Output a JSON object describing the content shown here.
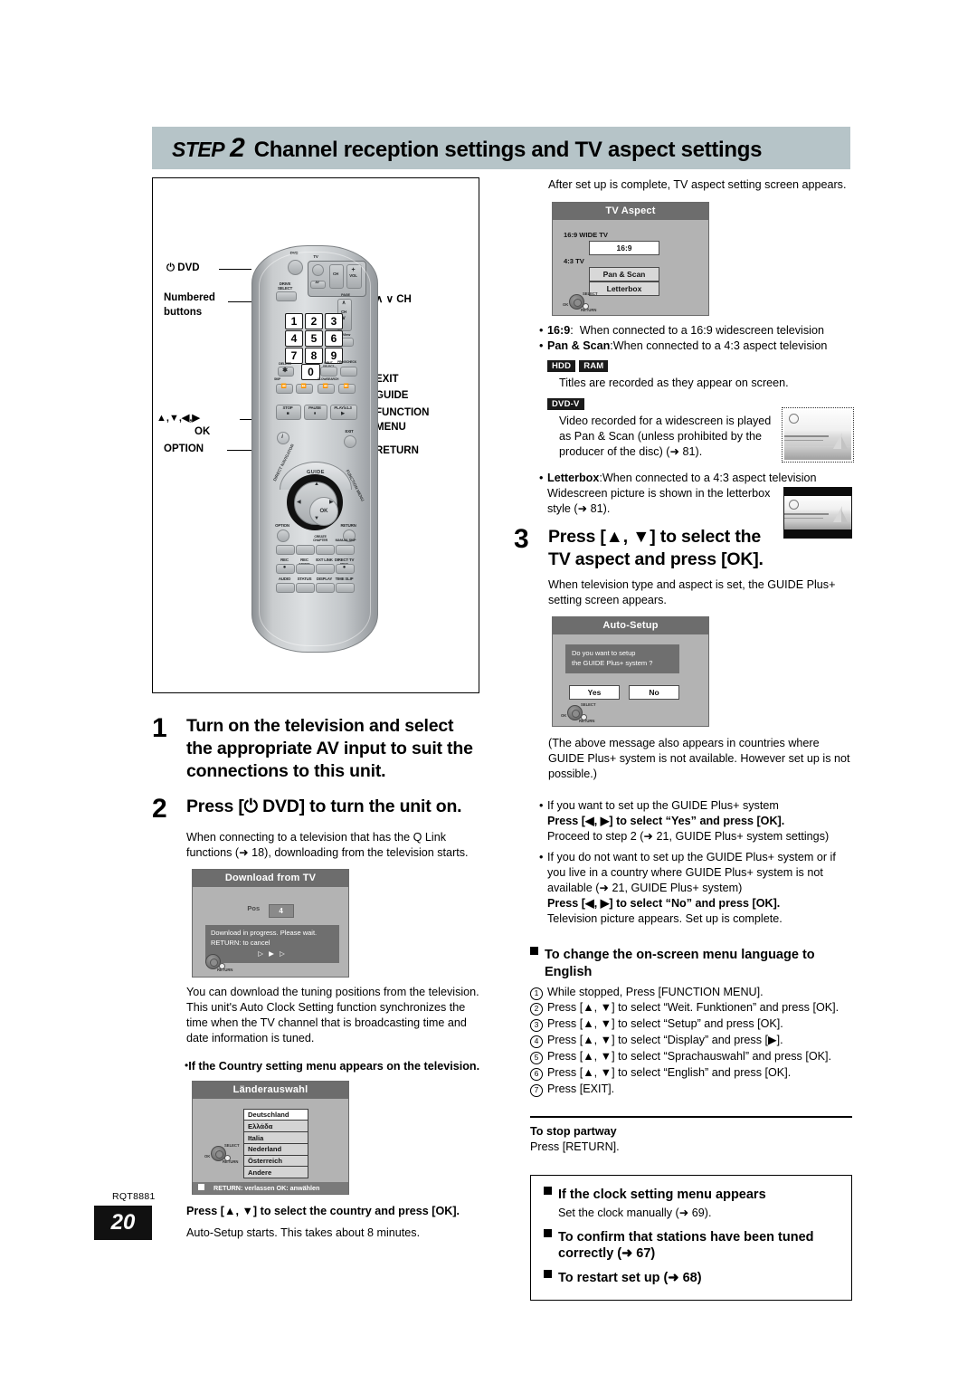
{
  "header": {
    "step_word": "STEP",
    "step_number": "2",
    "title": "Channel reception settings and TV aspect settings"
  },
  "remote_callouts": {
    "power_dvd": "⏻ DVD",
    "numbered_buttons": "Numbered\nbuttons",
    "ch": "∧ ∨ CH",
    "exit": "EXIT",
    "guide": "GUIDE",
    "function_menu": "FUNCTION\nMENU",
    "arrows_ok": "▲,▼,◀,▶",
    "ok": "OK",
    "option": "OPTION",
    "return": "RETURN"
  },
  "remote_face": {
    "dvd": "DVD",
    "tv": "TV",
    "drive_select": "DRIVE\nSELECT",
    "av": "AV",
    "ch": "CH",
    "vol": "VOL",
    "page": "PAGE",
    "showview": "ShowView",
    "delete": "DELETE",
    "input_select": "INPUT\nSELECT",
    "prog_check": "PROG/CHECK",
    "skip": "SKIP",
    "slow_search": "SLOW/SEARCH",
    "stop": "STOP",
    "pause": "PAUSE",
    "play": "PLAY/x1.3",
    "exit": "EXIT",
    "guide": "GUIDE",
    "direct_navigator": "DIRECT NAVIGATOR",
    "function_menu": "FUNCTION MENU",
    "ok": "OK",
    "option": "OPTION",
    "return": "RETURN",
    "create_chapter": "CREATE\nCHAPTER",
    "manual_skip": "MANUAL SKIP",
    "rec": "REC",
    "rec_mode": "REC MODE",
    "ext_link": "EXT LINK",
    "direct_tv_rec": "DIRECT TV REC",
    "audio": "AUDIO",
    "status": "STATUS",
    "display": "DISPLAY",
    "time_slip": "TIME SLIP",
    "numbers": [
      "1",
      "2",
      "3",
      "4",
      "5",
      "6",
      "7",
      "8",
      "9",
      "0"
    ]
  },
  "left": {
    "step1_num": "1",
    "step1_text": "Turn on the television and select the appropriate AV input to suit the connections to this unit.",
    "step2_num": "2",
    "step2_text": "Press [⏻ DVD] to turn the unit on.",
    "step2_note": "When connecting to a television that has the Q Link functions (➜ 18), downloading from the television starts.",
    "download_osd": {
      "title": "Download from TV",
      "pos_label": "Pos",
      "pos_value": "4",
      "message_line1": "Download in progress. Please wait.",
      "message_line2": "RETURN:  to cancel",
      "play_icons": "▷ ▶ ▷",
      "remote_return": "RETURN"
    },
    "download_note": "You can download the tuning positions from the television. This unit's Auto Clock Setting function synchronizes the time when the TV channel that is broadcasting time and date information is tuned.",
    "country_bullet": "If the Country setting menu appears on the television.",
    "country_osd": {
      "title": "Länderauswahl",
      "items": [
        "Deutschland",
        "Ελλάδα",
        "Italia",
        "Nederland",
        "Österreich",
        "Andere"
      ],
      "remote_select": "SELECT",
      "remote_ok": "OK",
      "remote_return": "RETURN",
      "footer": "RETURN: verlassen   OK: anwählen"
    },
    "country_instruction": "Press [▲, ▼] to select the country and press [OK].",
    "country_note": "Auto-Setup starts. This takes about 8 minutes."
  },
  "right": {
    "intro": "After set up is complete, TV aspect setting screen appears.",
    "tv_aspect_osd": {
      "title": "TV Aspect",
      "label_wide": "16:9 WIDE TV",
      "option_169": "16:9",
      "label_43": "4:3 TV",
      "option_pan_scan": "Pan & Scan",
      "option_letterbox": "Letterbox",
      "remote_select": "SELECT",
      "remote_ok": "OK",
      "remote_return": "RETURN"
    },
    "aspect_items": [
      {
        "term": "16:9",
        "sep": ":",
        "desc": "When connected to a 16:9 widescreen television"
      },
      {
        "term": "Pan & Scan",
        "sep": ":",
        "desc": "When connected to a 4:3 aspect television"
      }
    ],
    "badges_hdd_ram": [
      "HDD",
      "RAM"
    ],
    "hdd_ram_text": "Titles are recorded as they appear on screen.",
    "badge_dvdv": "DVD-V",
    "dvdv_text": "Video recorded for a widescreen is played as Pan & Scan (unless prohibited by the producer of the disc) (➜ 81).",
    "letterbox_term": "Letterbox",
    "letterbox_sep": ":",
    "letterbox_desc": "When connected to a 4:3 aspect television",
    "letterbox_text": "Widescreen picture is shown in the letterbox style (➜ 81).",
    "step3_num": "3",
    "step3_text": "Press [▲, ▼] to select the TV aspect and press [OK].",
    "step3_note": "When television type and aspect is set, the GUIDE Plus+ setting screen appears.",
    "autosetup_osd": {
      "title": "Auto-Setup",
      "message_line1": "Do you want to setup",
      "message_line2": "the GUIDE Plus+ system ?",
      "yes": "Yes",
      "no": "No",
      "remote_select": "SELECT",
      "remote_ok": "OK",
      "remote_return": "RETURN"
    },
    "autosetup_note": "(The above message also appears in countries where GUIDE Plus+ system is not available. However set up is not possible.)",
    "guide_yes": {
      "bullet": "If you want to set up the GUIDE Plus+ system",
      "bold": "Press [◀, ▶] to select “Yes” and press [OK].",
      "note": "Proceed to step 2 (➜ 21, GUIDE Plus+ system settings)"
    },
    "guide_no": {
      "bullet": "If you do not want to set up the GUIDE Plus+ system or if you live in a country where GUIDE Plus+ system is not available (➜ 21, GUIDE Plus+ system)",
      "bold": "Press [◀, ▶] to select “No” and press [OK].",
      "note": "Television picture appears. Set up is complete."
    },
    "language_heading": "To change the on-screen menu language to English",
    "language_steps": [
      "While stopped, Press [FUNCTION MENU].",
      "Press [▲, ▼] to select “Weit. Funktionen” and press [OK].",
      "Press [▲, ▼] to select “Setup” and press [OK].",
      "Press [▲, ▼] to select “Display” and press [▶].",
      "Press [▲, ▼] to select “Sprachauswahl” and press [OK].",
      "Press [▲, ▼] to select “English” and press [OK].",
      "Press [EXIT]."
    ],
    "stop_partway_title": "To stop partway",
    "stop_partway_text": "Press [RETURN].",
    "boxed_items": [
      {
        "heading": "If the clock setting menu appears",
        "note": "Set the clock manually (➜ 69)."
      },
      {
        "heading": "To confirm that stations have been tuned correctly (➜ 67)",
        "note": ""
      },
      {
        "heading": "To restart set up (➜ 68)",
        "note": ""
      }
    ]
  },
  "footer": {
    "rqt": "RQT8881",
    "page": "20"
  }
}
